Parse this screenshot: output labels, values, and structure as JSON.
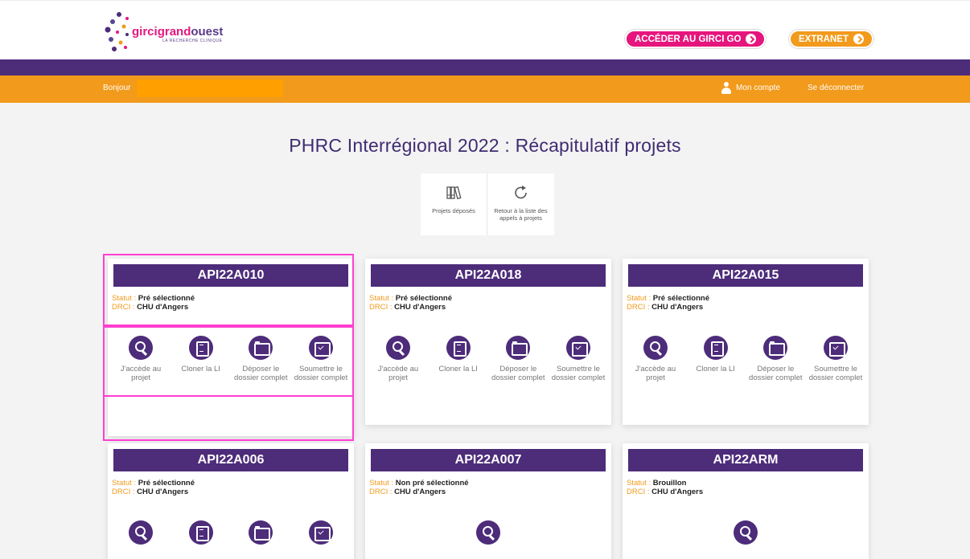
{
  "header": {
    "logo": {
      "part1": "girci",
      "part2": "grand",
      "part3": "ouest",
      "tagline": "LA RECHERCHE CLINIQUE"
    },
    "buttons": {
      "girci_go": "ACCÉDER AU GIRCI GO",
      "extranet": "EXTRANET"
    }
  },
  "userbar": {
    "greeting": "Bonjour",
    "account": "Mon compte",
    "logout": "Se déconnecter"
  },
  "page": {
    "title": "PHRC Interrégional 2022 : Récapitulatif projets"
  },
  "tools": {
    "submitted": "Projets déposés",
    "back": "Retour à la liste des appels à projets"
  },
  "labels": {
    "statut": "Statut :",
    "drci": "DRCI :",
    "access": "J'accède au projet",
    "clone": "Cloner la LI",
    "deposit": "Déposer le dossier complet",
    "submit": "Soumettre le dossier complet"
  },
  "cards": [
    {
      "id": "API22A010",
      "statut": "Pré sélectionné",
      "drci": "CHU d'Angers"
    },
    {
      "id": "API22A018",
      "statut": "Pré sélectionné",
      "drci": "CHU d'Angers"
    },
    {
      "id": "API22A015",
      "statut": "Pré sélectionné",
      "drci": "CHU d'Angers"
    },
    {
      "id": "API22A006",
      "statut": "Pré sélectionné",
      "drci": "CHU d'Angers"
    },
    {
      "id": "API22A007",
      "statut": "Non pré sélectionné",
      "drci": "CHU d'Angers"
    },
    {
      "id": "API22ARM",
      "statut": "Brouillon",
      "drci": "CHU d'Angers"
    }
  ],
  "colors": {
    "purple": "#4d2c7a",
    "orange": "#f29a1b",
    "pink": "#e6157d",
    "highlight": "#ff3fd0"
  }
}
